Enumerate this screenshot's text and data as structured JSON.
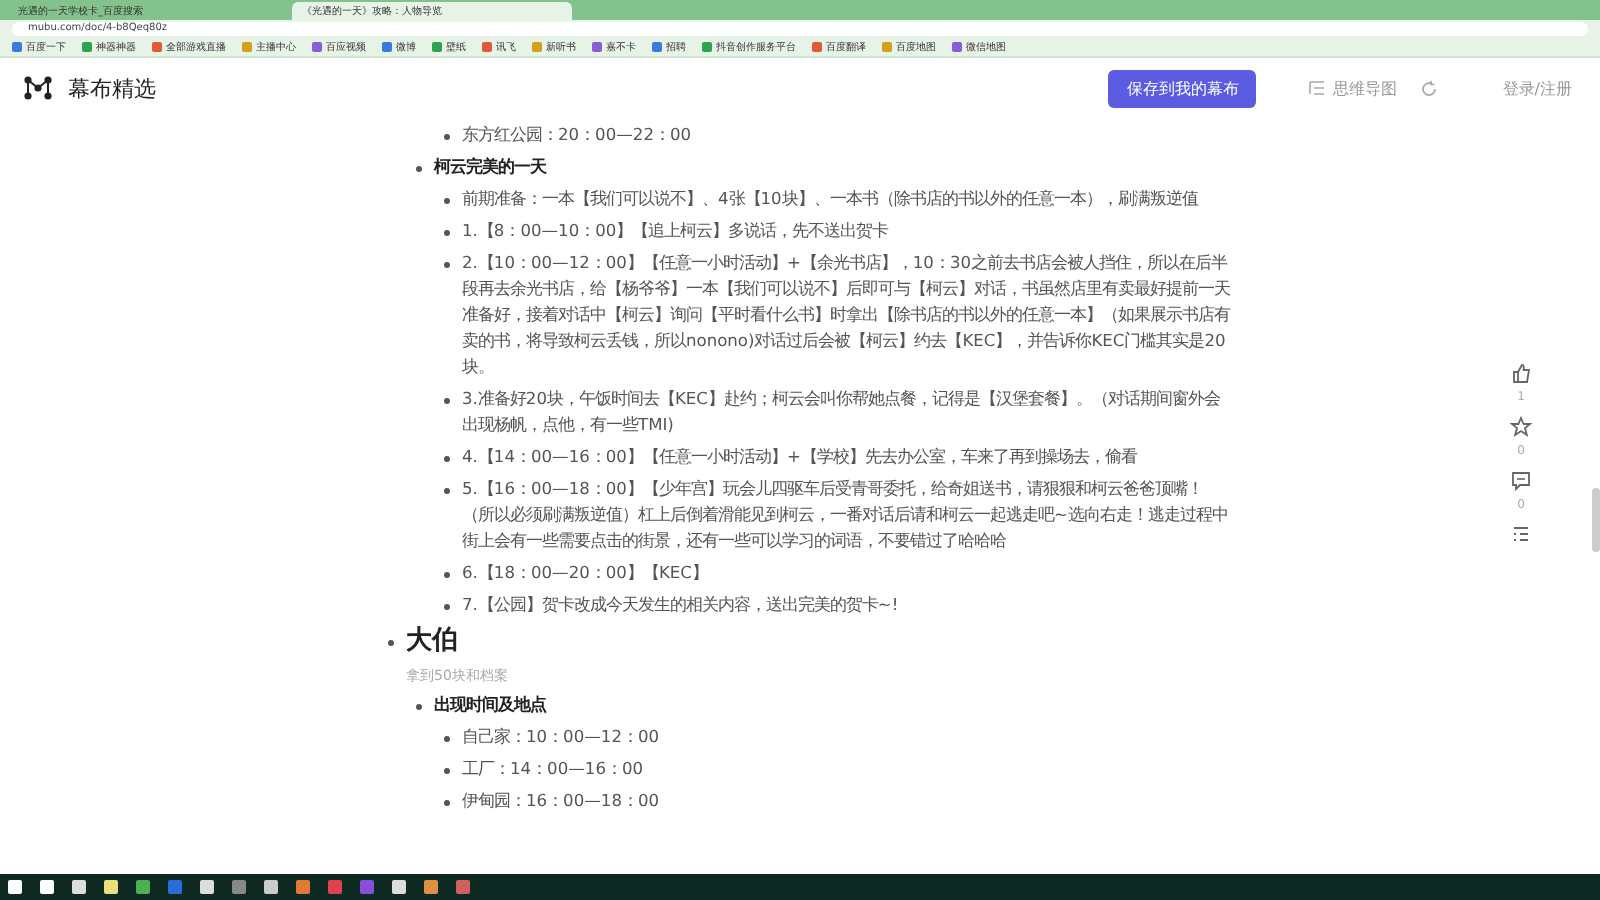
{
  "browser": {
    "tabs": [
      {
        "title": "光遇的一天学校卡_百度搜索",
        "selected": false
      },
      {
        "title": "《光遇的一天》攻略：人物导览",
        "selected": true
      }
    ],
    "url": "mubu.com/doc/4-b8Qeq80z",
    "bookmarks": [
      "百度一下",
      "神器神器",
      "全部游戏直播",
      "主播中心",
      "百应视频",
      "微博",
      "壁纸",
      "讯飞",
      "新听书",
      "嘉不卡",
      "招聘",
      "抖音创作服务平台",
      "百度翻译",
      "百度地图",
      "微信地图"
    ]
  },
  "header": {
    "logo_text": "幕布精选",
    "save_button": "保存到我的幕布",
    "mindmap_button": "思维导图",
    "login": "登录/注册"
  },
  "outline": [
    {
      "kind": "heading",
      "children": [
        {
          "kind": "section",
          "children": [
            {
              "kind": "item",
              "text": "东方红公园：20：00—22：00"
            }
          ]
        },
        {
          "kind": "section",
          "text": "柯云完美的一天",
          "children": [
            {
              "kind": "item",
              "text": "前期准备：一本【我们可以说不】、4张【10块】、一本书（除书店的书以外的任意一本），刷满叛逆值"
            },
            {
              "kind": "item",
              "text": "1.【8：00—10：00】【追上柯云】多说话，先不送出贺卡"
            },
            {
              "kind": "item",
              "text": "2.【10：00—12：00】【任意一小时活动】+【余光书店】，10：30之前去书店会被人挡住，所以在后半段再去余光书店，给【杨爷爷】一本【我们可以说不】后即可与【柯云】对话，书虽然店里有卖最好提前一天准备好，接着对话中【柯云】询问【平时看什么书】时拿出【除书店的书以外的任意一本】（如果展示书店有卖的书，将导致柯云丢钱，所以nonono)对话过后会被【柯云】约去【KEC】，并告诉你KEC门槛其实是20块。"
            },
            {
              "kind": "item",
              "text": "3.准备好20块，午饭时间去【KEC】赴约；柯云会叫你帮她点餐，记得是【汉堡套餐】。（对话期间窗外会出现杨帆，点他，有一些TMI)"
            },
            {
              "kind": "item",
              "text": "4.【14：00—16：00】【任意一小时活动】+【学校】先去办公室，车来了再到操场去，偷看"
            },
            {
              "kind": "item",
              "text": "5.【16：00—18：00】【少年宫】玩会儿四驱车后受青哥委托，给奇姐送书，请狠狠和柯云爸爸顶嘴！（所以必须刷满叛逆值）杠上后倒着滑能见到柯云，一番对话后请和柯云一起逃走吧~选向右走！逃走过程中街上会有一些需要点击的街景，还有一些可以学习的词语，不要错过了哈哈哈"
            },
            {
              "kind": "item",
              "text": "6.【18：00—20：00】【KEC】"
            },
            {
              "kind": "item",
              "text": "7.【公园】贺卡改成今天发生的相关内容，送出完美的贺卡~!"
            }
          ]
        }
      ]
    },
    {
      "kind": "heading",
      "text": "大伯",
      "note": "拿到50块和档案",
      "children": [
        {
          "kind": "section",
          "text": "出现时间及地点",
          "children": [
            {
              "kind": "item",
              "text": "自己家：10：00—12：00"
            },
            {
              "kind": "item",
              "text": "工厂：14：00—16：00"
            },
            {
              "kind": "item",
              "text": "伊甸园：16：00—18：00"
            }
          ]
        }
      ]
    }
  ],
  "actions": [
    {
      "kind": "like",
      "count": "1"
    },
    {
      "kind": "star",
      "count": "0"
    },
    {
      "kind": "comment",
      "count": "0"
    },
    {
      "kind": "outline"
    }
  ]
}
